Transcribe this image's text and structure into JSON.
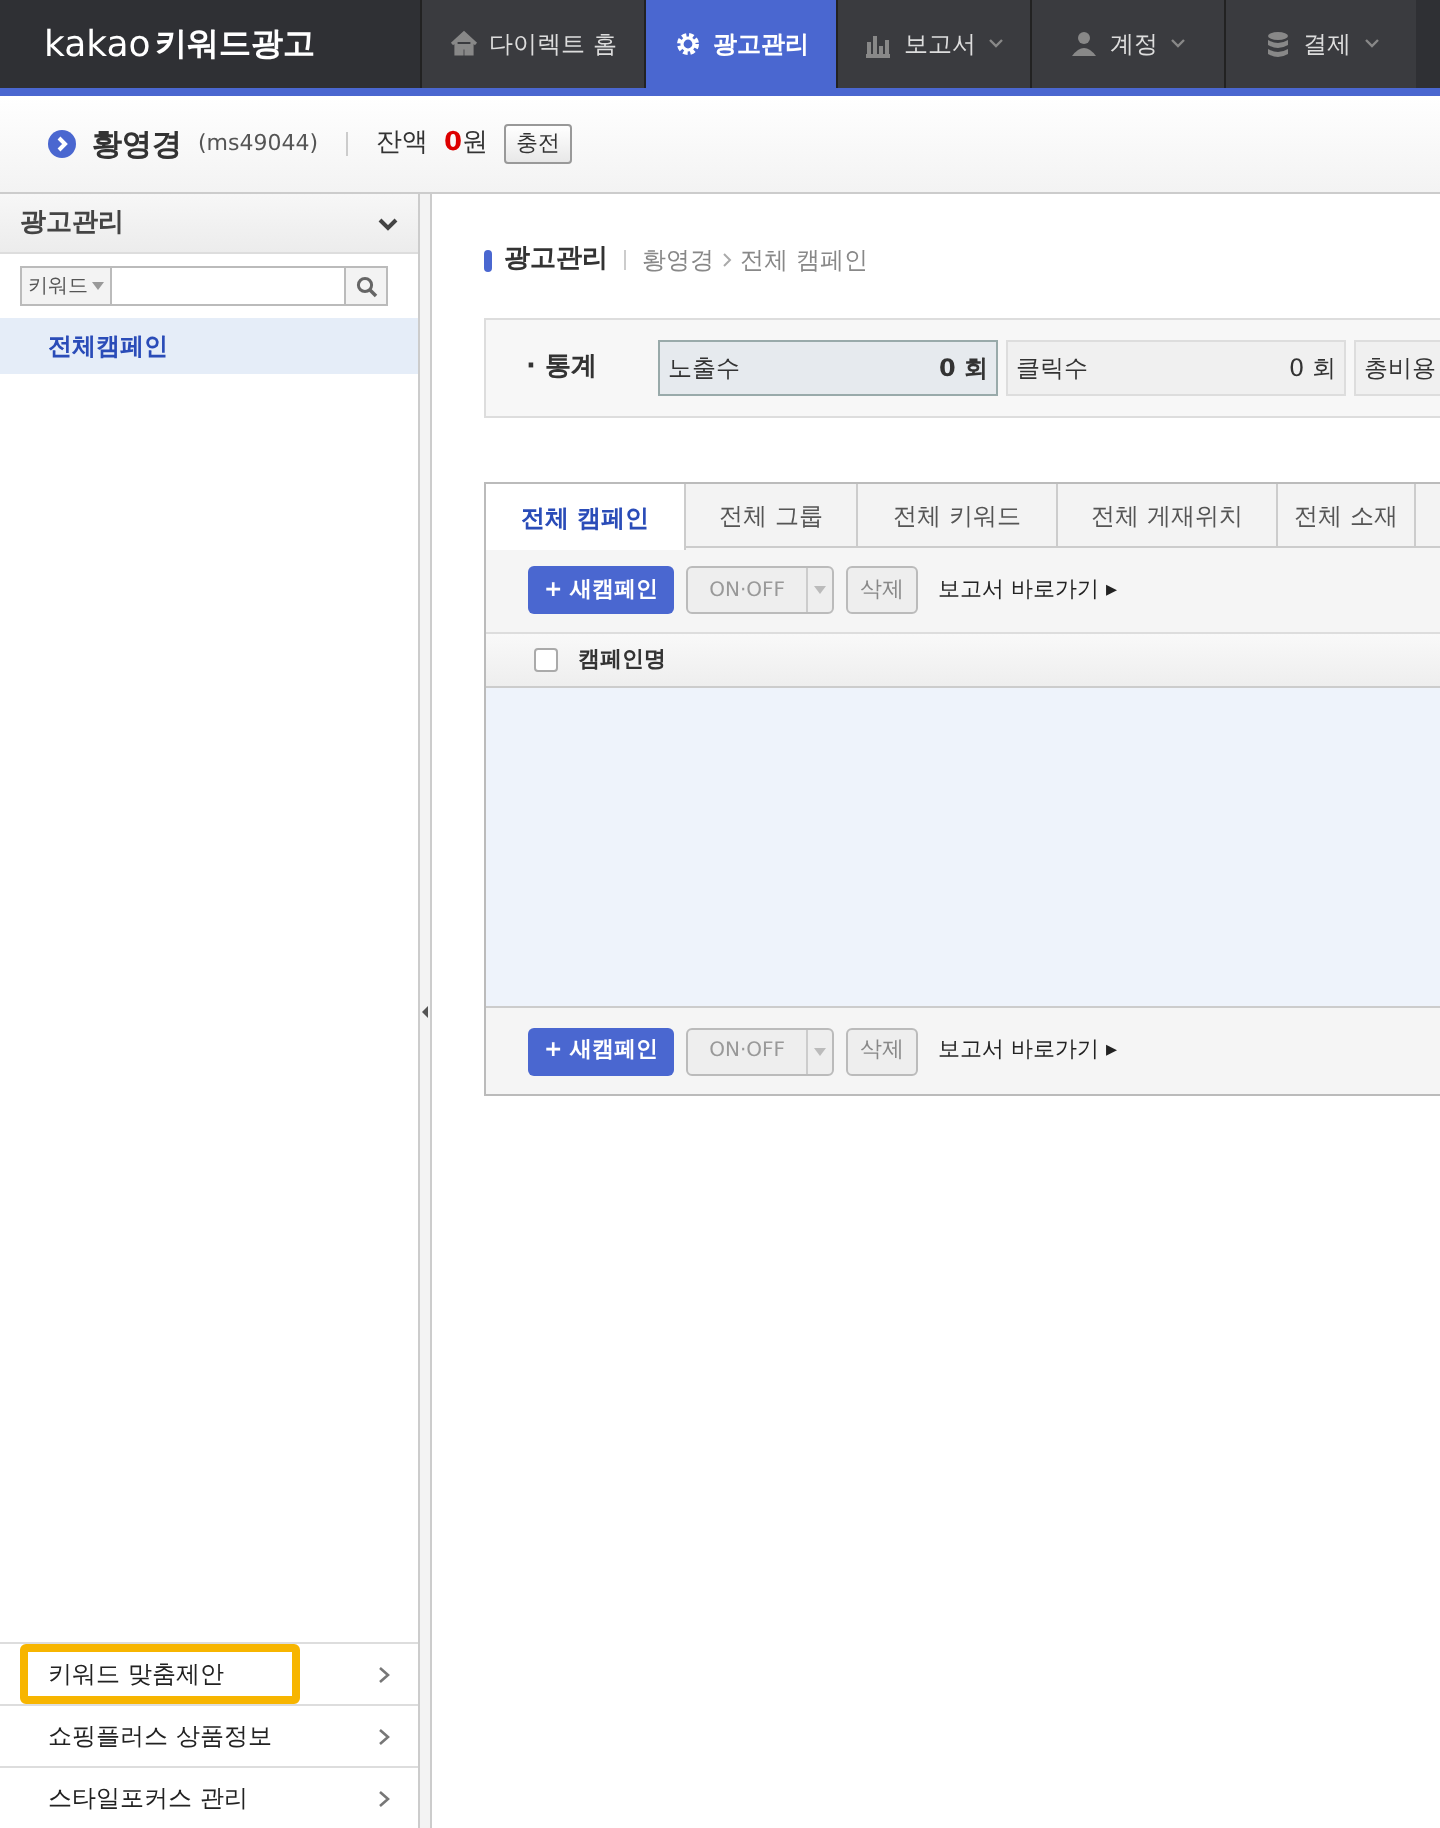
{
  "header": {
    "logo": {
      "brand": "kakao",
      "product": "키워드광고"
    },
    "nav": [
      {
        "label": "다이렉트 홈",
        "selected": false,
        "dropdown": false
      },
      {
        "label": "광고관리",
        "selected": true,
        "dropdown": false
      },
      {
        "label": "보고서",
        "selected": false,
        "dropdown": true
      },
      {
        "label": "계정",
        "selected": false,
        "dropdown": true
      },
      {
        "label": "결제",
        "selected": false,
        "dropdown": true
      }
    ]
  },
  "account": {
    "name": "황영경",
    "id": "(ms49044)",
    "balance_label": "잔액",
    "balance_value": "0",
    "balance_unit": "원",
    "charge_button": "충전"
  },
  "sidebar": {
    "title": "광고관리",
    "search": {
      "filter": "키워드"
    },
    "tree": [
      {
        "label": "전체캠페인",
        "selected": true
      }
    ],
    "bottom_items": [
      {
        "label": "키워드 맞춤제안",
        "highlighted": true
      },
      {
        "label": "쇼핑플러스 상품정보",
        "highlighted": false
      },
      {
        "label": "스타일포커스 관리",
        "highlighted": false
      }
    ]
  },
  "breadcrumb": {
    "section": "광고관리",
    "path": [
      "황영경",
      "전체 캠페인"
    ]
  },
  "stats": {
    "label": "· 통계",
    "items": [
      {
        "label": "노출수",
        "value": "0 회",
        "selected": true
      },
      {
        "label": "클릭수",
        "value": "0 회",
        "selected": false
      },
      {
        "label": "총비용",
        "value": "",
        "selected": false
      }
    ]
  },
  "tabs": [
    {
      "label": "전체 캠페인",
      "selected": true
    },
    {
      "label": "전체 그룹",
      "selected": false
    },
    {
      "label": "전체 키워드",
      "selected": false
    },
    {
      "label": "전체 게재위치",
      "selected": false
    },
    {
      "label": "전체 소재",
      "selected": false
    }
  ],
  "toolbars": [
    {
      "new_button": "+ 새캠페인",
      "toggle": "ON·OFF",
      "delete_button": "삭제",
      "report_link": "보고서 바로가기 ▸"
    },
    {
      "new_button": "+ 새캠페인",
      "toggle": "ON·OFF",
      "delete_button": "삭제",
      "report_link": "보고서 바로가기 ▸"
    }
  ],
  "table": {
    "columns": [
      "캠페인명"
    ],
    "select_all_checked": false
  }
}
